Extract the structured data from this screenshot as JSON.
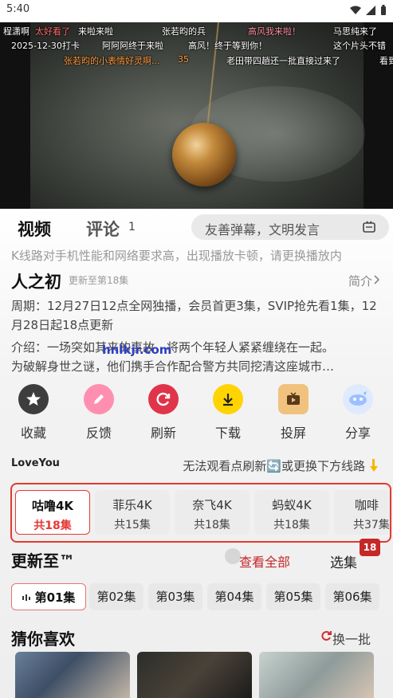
{
  "status": {
    "time": "5:40"
  },
  "danmaku": [
    {
      "text": "程潇啊",
      "color": "#ffffff"
    },
    {
      "text": "太好看了",
      "color": "#ff6b6b"
    },
    {
      "text": "来啦来啦",
      "color": "#ffffff"
    },
    {
      "text": "张若昀的兵",
      "color": "#ffffff"
    },
    {
      "text": "高风我来啦！",
      "color": "#ff8fa0"
    },
    {
      "text": "马思纯来了",
      "color": "#ffffff"
    },
    {
      "text": "2025-12-30打卡",
      "color": "#ffffff"
    },
    {
      "text": "阿阿阿终于来啦",
      "color": "#ffffff"
    },
    {
      "text": "高风！终于等到你！",
      "color": "#ffffff"
    },
    {
      "text": "这个片头不错",
      "color": "#ffffff"
    },
    {
      "text": "张若昀的小表情好灵啊...",
      "color": "#ff9a3c"
    },
    {
      "text": "35",
      "color": "#ff9a3c"
    },
    {
      "text": "老田带四趟还一批直接过来了",
      "color": "#ffffff"
    },
    {
      "text": "看到",
      "color": "#ffffff"
    }
  ],
  "tabs": {
    "video": "视频",
    "comment": "评论",
    "comment_count": "1"
  },
  "danmu_input": {
    "placeholder": "友善弹幕，文明发言"
  },
  "notice": "K线路对手机性能和网络要求高，出现播放卡顿，请更换播放内",
  "show": {
    "title": "人之初",
    "update_status": "更新至第18集",
    "intro_link": "简介",
    "schedule": "周期：12月27日12点全网独播，会员首更3集，SVIP抢先看1集，12月28日起18点更新",
    "intro": "介绍：一场突如其来的事故，将两个年轻人紧紧缠绕在一起。",
    "intro_2": "为破解身世之谜，他们携手合作配合警方共同挖清这座城市…",
    "watermark": "hnlkjr.com"
  },
  "actions": [
    {
      "label": "收藏",
      "icon": "star-icon",
      "color": "#3d3d3d"
    },
    {
      "label": "反馈",
      "icon": "pencil-icon",
      "color": "#ff8fb0"
    },
    {
      "label": "刷新",
      "icon": "refresh-icon",
      "color": "#e0344a"
    },
    {
      "label": "下载",
      "icon": "download-icon",
      "color": "#ffd400"
    },
    {
      "label": "投屏",
      "icon": "tv-icon",
      "color": "#f1c27d"
    },
    {
      "label": "分享",
      "icon": "share-icon",
      "color": "#7fb0ff"
    }
  ],
  "line_tip": {
    "logo": "LoveYou",
    "text": "无法观看点刷新🔄或更换下方线路"
  },
  "sources": [
    {
      "name": "咕噜4K",
      "count": "共18集",
      "active": true
    },
    {
      "name": "菲乐4K",
      "count": "共15集",
      "active": false
    },
    {
      "name": "奈飞4K",
      "count": "共18集",
      "active": false
    },
    {
      "name": "蚂蚁4K",
      "count": "共18集",
      "active": false
    },
    {
      "name": "咖啡",
      "count": "共37集",
      "active": false
    }
  ],
  "badge": "18",
  "episodes_section": {
    "title": "更新至™",
    "view_all": "查看全部",
    "select": "选集"
  },
  "episodes": [
    "第01集",
    "第02集",
    "第03集",
    "第04集",
    "第05集",
    "第06集"
  ],
  "guess": {
    "title": "猜你喜欢",
    "refresh": "换一批"
  },
  "colors": {
    "accent_red": "#e53935",
    "border_red": "#e23a2e"
  }
}
